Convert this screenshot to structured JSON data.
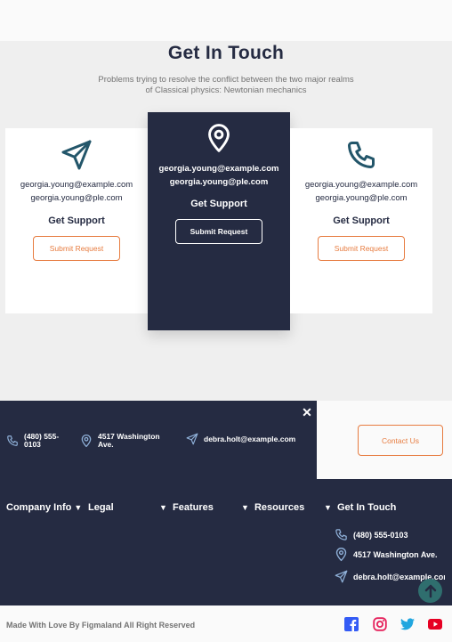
{
  "header": {
    "title": "Get In Touch",
    "subtitle_line1": "Problems trying to resolve the conflict between the two major realms",
    "subtitle_line2": "of Classical physics: Newtonian mechanics"
  },
  "cards": [
    {
      "icon": "send-icon",
      "email1": "georgia.young@example.com",
      "email2": "georgia.young@ple.com",
      "support": "Get Support",
      "button": "Submit Request"
    },
    {
      "icon": "map-pin-icon",
      "email1": "georgia.young@example.com",
      "email2": "georgia.young@ple.com",
      "support": "Get Support",
      "button": "Submit Request"
    },
    {
      "icon": "phone-icon",
      "email1": "georgia.young@example.com",
      "email2": "georgia.young@ple.com",
      "support": "Get Support",
      "button": "Submit Request"
    }
  ],
  "footer_top": {
    "close": "✕",
    "phone_line1": "(480) 555-",
    "phone_line2": "0103",
    "address_line1": "4517 Washington",
    "address_line2": "Ave.",
    "email": "debra.holt@example.com",
    "contact_button": "Contact Us"
  },
  "footer_nav": {
    "items": [
      "Company Info",
      "Legal",
      "Features",
      "Resources",
      "Get In Touch"
    ],
    "get_in_touch": {
      "phone": "(480) 555-0103",
      "address": "4517 Washington Ave.",
      "email": "debra.holt@example.com"
    }
  },
  "bottom": {
    "copyright": "Made With Love By Figmaland All Right Reserved",
    "social": [
      "facebook-icon",
      "instagram-icon",
      "twitter-icon",
      "youtube-icon"
    ]
  },
  "colors": {
    "navy": "#252b42",
    "accent": "#e77c40",
    "teal": "#23856d",
    "muted": "#737373"
  }
}
